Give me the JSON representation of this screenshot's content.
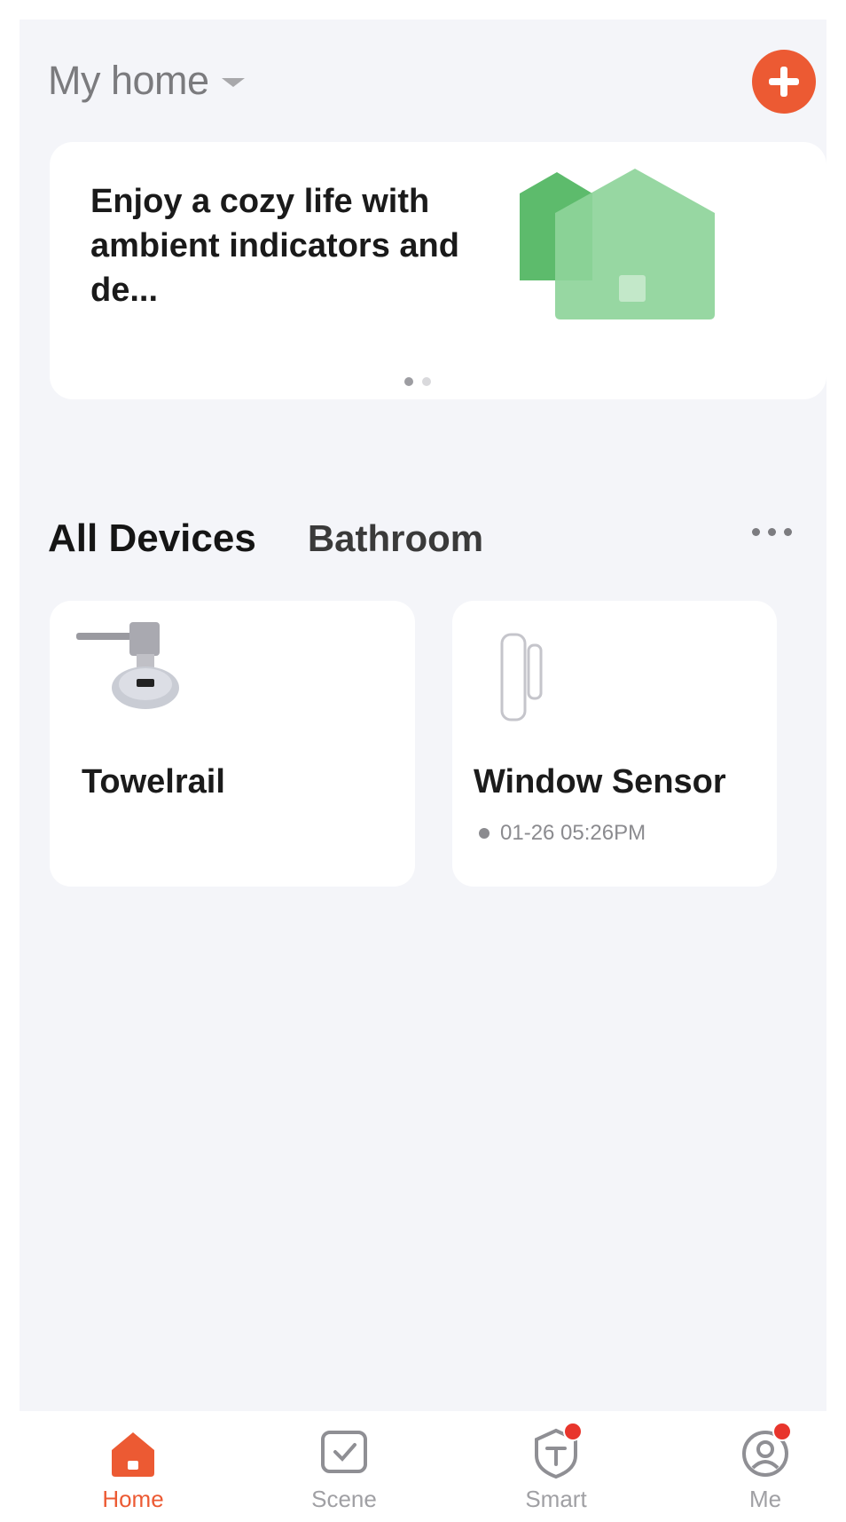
{
  "header": {
    "home_name": "My home",
    "add_icon": "plus-circle-icon",
    "accent_color": "#ec5a33"
  },
  "banner": {
    "text": "Enjoy a cozy life with ambient indicators and de...",
    "image_icon": "green-house-illustration",
    "page_count": 2,
    "active_page": 1
  },
  "tabs": {
    "items": [
      "All Devices",
      "Bathroom"
    ],
    "selected": "All Devices",
    "more_icon": "more-dots-icon"
  },
  "devices": [
    {
      "name": "Towelrail",
      "icon": "towel-rail-valve-icon"
    },
    {
      "name": "Window Sensor",
      "icon": "door-window-sensor-icon",
      "status": "01-26 05:26PM"
    }
  ],
  "bottom_nav": {
    "items": [
      {
        "label": "Home",
        "icon": "home-icon",
        "active": true,
        "badge": false
      },
      {
        "label": "Scene",
        "icon": "scene-icon",
        "active": false,
        "badge": false
      },
      {
        "label": "Smart",
        "icon": "smart-icon",
        "active": false,
        "badge": true
      },
      {
        "label": "Me",
        "icon": "me-icon",
        "active": false,
        "badge": true
      }
    ]
  }
}
